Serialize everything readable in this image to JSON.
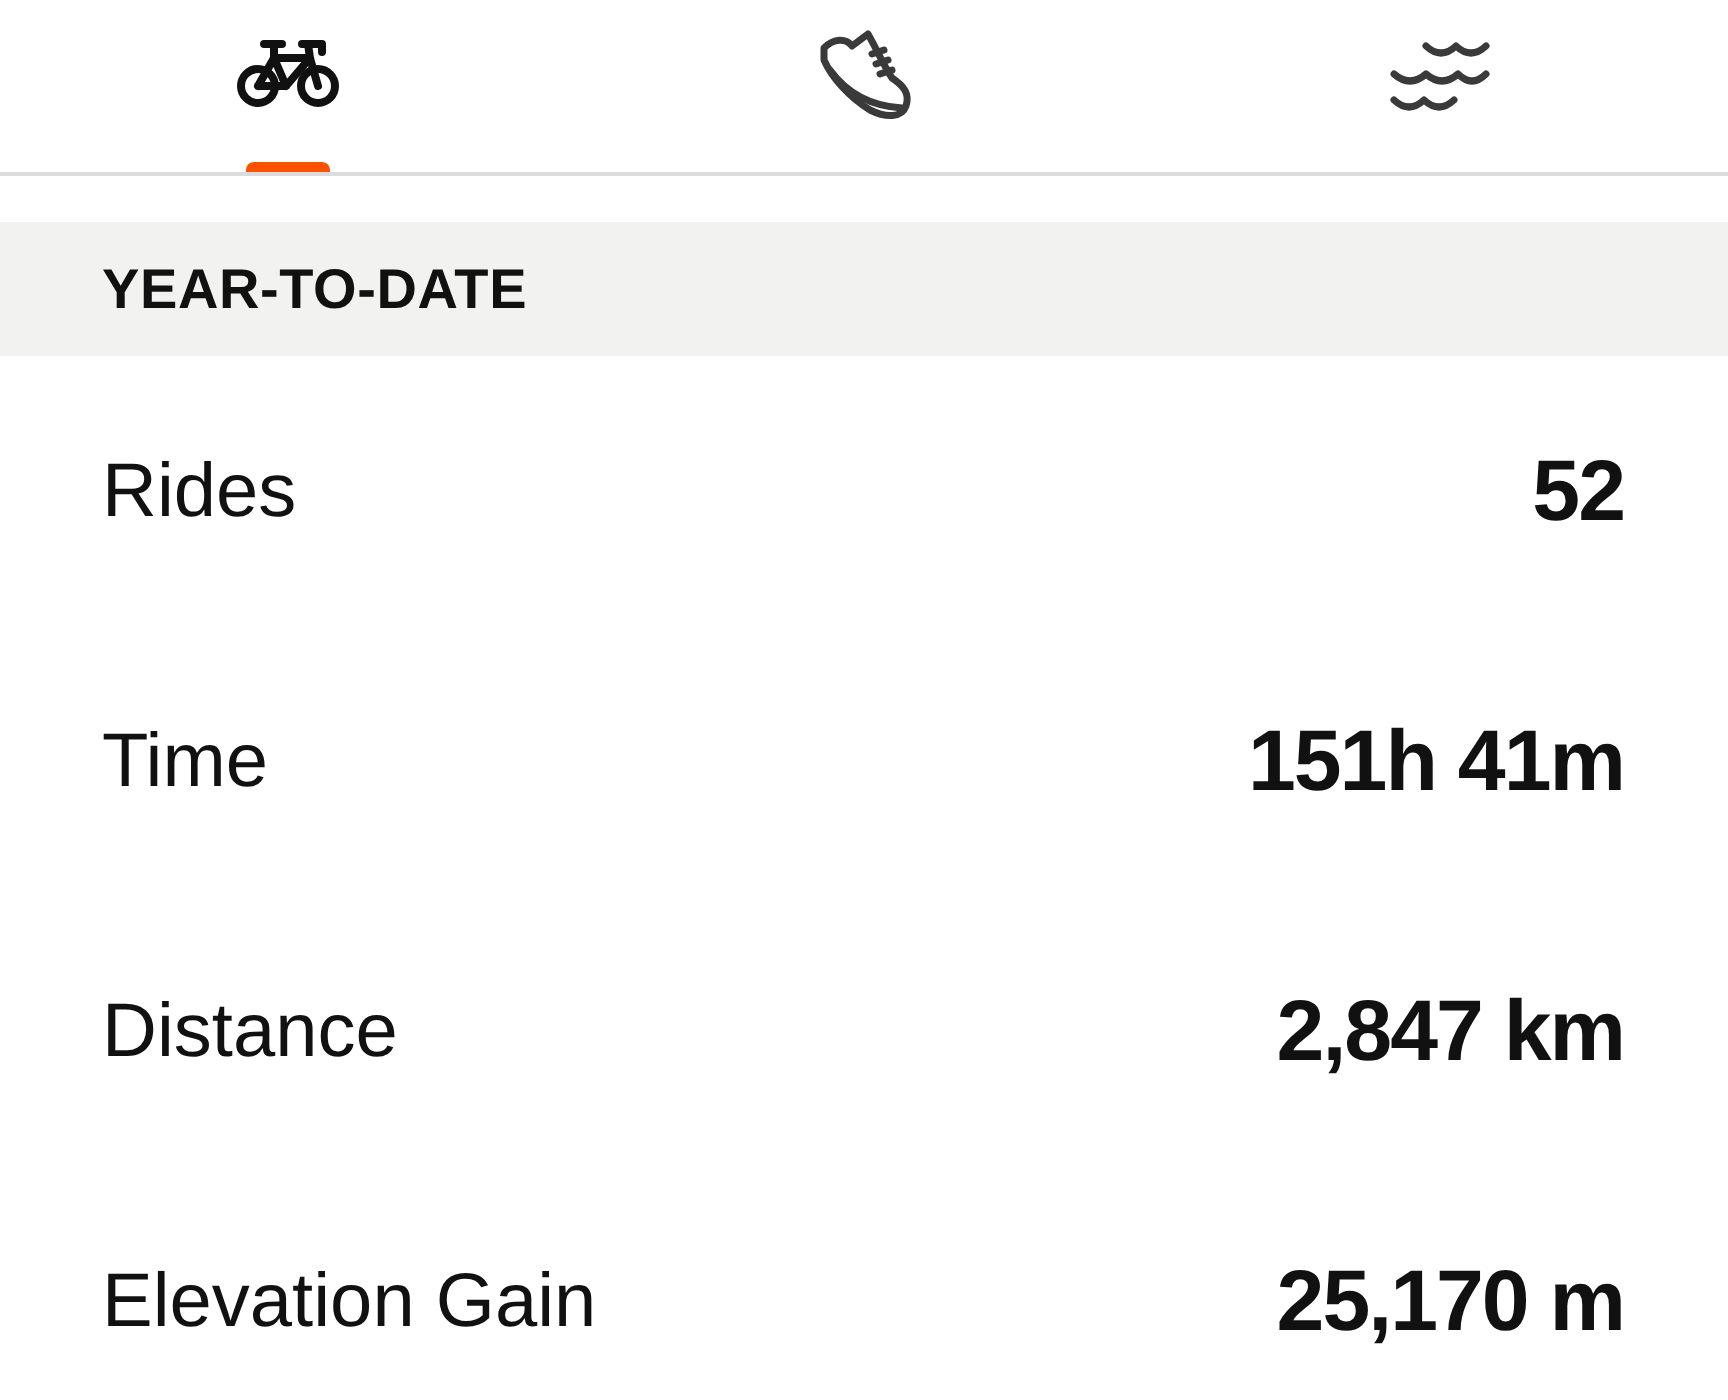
{
  "tabs": [
    {
      "kind": "bike",
      "selected": true
    },
    {
      "kind": "shoe",
      "selected": false
    },
    {
      "kind": "waves",
      "selected": false
    }
  ],
  "section": {
    "title": "YEAR-TO-DATE"
  },
  "stats": [
    {
      "label": "Rides",
      "value": "52"
    },
    {
      "label": "Time",
      "value": "151h 41m"
    },
    {
      "label": "Distance",
      "value": "2,847 km"
    },
    {
      "label": "Elevation Gain",
      "value": "25,170 m"
    }
  ]
}
